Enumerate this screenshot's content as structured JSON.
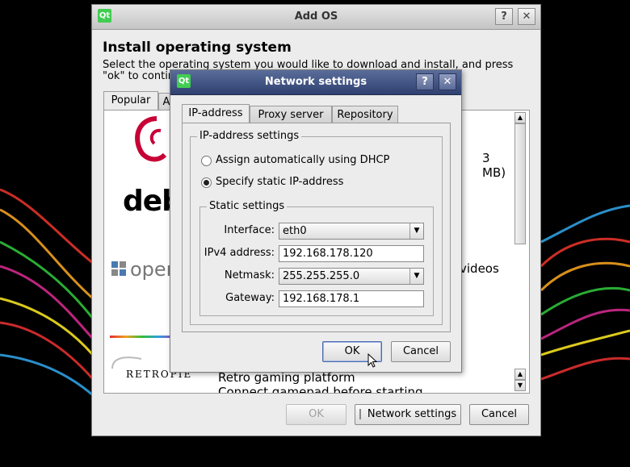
{
  "add_os": {
    "title": "Add OS",
    "help_label": "?",
    "close_label": "✕",
    "heading": "Install operating system",
    "description": "Select the operating system you would like to download and install, and press \"ok\" to continue.",
    "tabs": [
      {
        "label": "Popular"
      },
      {
        "label": "A"
      }
    ],
    "os_list": [
      {
        "logo_text": "debi",
        "info": "3 MB)"
      },
      {
        "logo_text": "oper",
        "info": "videos"
      },
      {
        "logo_text": "RETROPIE",
        "name": "Retro gaming platform",
        "info": "Connect gamepad before starting"
      }
    ],
    "buttons": {
      "ok": "OK",
      "network": "Network settings",
      "cancel": "Cancel"
    }
  },
  "network": {
    "title": "Network settings",
    "help_label": "?",
    "close_label": "✕",
    "tabs": [
      {
        "label": "IP-address"
      },
      {
        "label": "Proxy server"
      },
      {
        "label": "Repository"
      }
    ],
    "ip_group_title": "IP-address settings",
    "dhcp_label": "Assign automatically using DHCP",
    "static_label": "Specify static IP-address",
    "static_group_title": "Static settings",
    "interface_label": "Interface:",
    "interface_value": "eth0",
    "ipv4_label": "IPv4 address:",
    "ipv4_value": "192.168.178.120",
    "netmask_label": "Netmask:",
    "netmask_value": "255.255.255.0",
    "gateway_label": "Gateway:",
    "gateway_value": "192.168.178.1",
    "ok_label": "OK",
    "cancel_label": "Cancel"
  },
  "icons": {
    "app": "qt-logo-icon",
    "cursor": "mouse-pointer-icon",
    "dropdown": "chevron-down-icon"
  }
}
